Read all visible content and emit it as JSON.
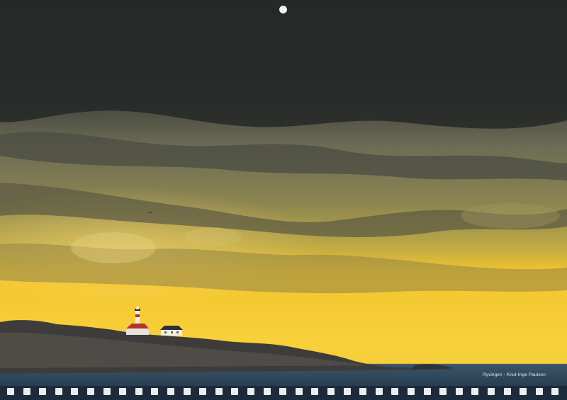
{
  "photo": {
    "description_icon": "lighthouse-island-photo",
    "caption": "Ryvingen - Knut-Inge Paulsen"
  },
  "colors": {
    "sky_dark": "#2b2f2c",
    "sky_gold": "#f5c92c",
    "sea": "#2c4457",
    "rock": "#3b3a38"
  }
}
